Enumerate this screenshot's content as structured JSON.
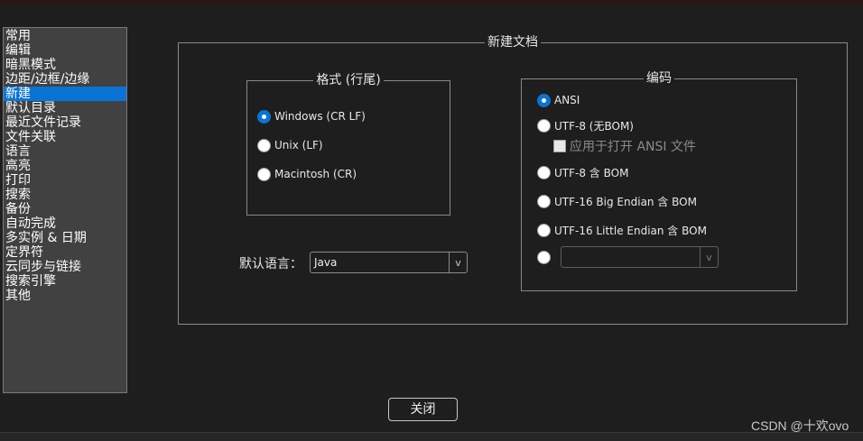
{
  "sidebar": {
    "items": [
      {
        "label": "常用"
      },
      {
        "label": "编辑"
      },
      {
        "label": "暗黑模式"
      },
      {
        "label": "边距/边框/边缘"
      },
      {
        "label": "新建",
        "selected": true
      },
      {
        "label": "默认目录"
      },
      {
        "label": "最近文件记录"
      },
      {
        "label": "文件关联"
      },
      {
        "label": "语言"
      },
      {
        "label": "高亮"
      },
      {
        "label": "打印"
      },
      {
        "label": "搜索"
      },
      {
        "label": "备份"
      },
      {
        "label": "自动完成"
      },
      {
        "label": "多实例 & 日期"
      },
      {
        "label": "定界符"
      },
      {
        "label": "云同步与链接"
      },
      {
        "label": "搜索引擎"
      },
      {
        "label": "其他"
      }
    ]
  },
  "main": {
    "title": "新建文档",
    "format": {
      "title": "格式 (行尾)",
      "options": [
        {
          "label": "Windows (CR LF)",
          "checked": true
        },
        {
          "label": "Unix (LF)",
          "checked": false
        },
        {
          "label": "Macintosh (CR)",
          "checked": false
        }
      ]
    },
    "encoding": {
      "title": "编码",
      "ansi": "ANSI",
      "utf8": "UTF-8 (无BOM)",
      "apply_ansi": "应用于打开 ANSI 文件",
      "utf8_bom": "UTF-8 含 BOM",
      "utf16be": "UTF-16 Big Endian 含 BOM",
      "utf16le": "UTF-16 Little Endian 含 BOM",
      "other_value": ""
    },
    "default_language": {
      "label": "默认语言：",
      "value": "Java"
    },
    "close_label": "关闭"
  },
  "combo_arrow": "v",
  "watermark": "CSDN @十欢ovo",
  "colors": {
    "background": "#1e1e1e",
    "sidebar_bg": "#414141",
    "selected": "#0a74d6",
    "border": "#8a8a8a"
  }
}
